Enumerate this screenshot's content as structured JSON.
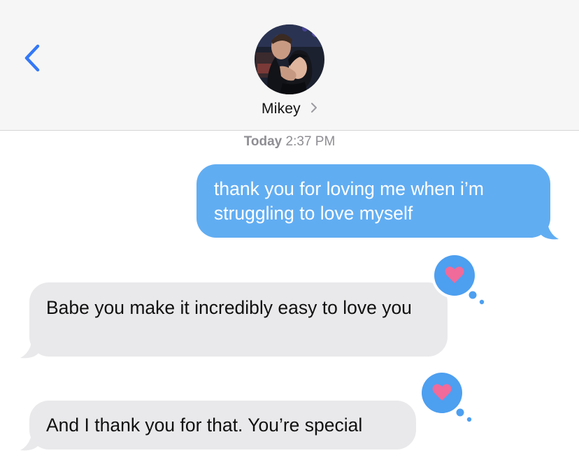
{
  "header": {
    "contact_name": "Mikey",
    "back_icon": "chevron-left-icon",
    "disclosure_icon": "chevron-right-icon",
    "accent_color": "#3478f6"
  },
  "conversation": {
    "timestamp_day": "Today",
    "timestamp_time": "2:37 PM",
    "messages": [
      {
        "direction": "sent",
        "text": "thank you for loving me when i’m struggling to love myself",
        "color": "#61adf2"
      },
      {
        "direction": "received",
        "text": "Babe you make it incredibly easy to love you",
        "reaction": "heart",
        "color": "#e9e9eb"
      },
      {
        "direction": "received",
        "text": "And I thank you for that. You’re special",
        "reaction": "heart",
        "color": "#e9e9eb"
      }
    ],
    "reaction_colors": {
      "badge": "#4d9ff0",
      "heart": "#f06a9a"
    }
  }
}
